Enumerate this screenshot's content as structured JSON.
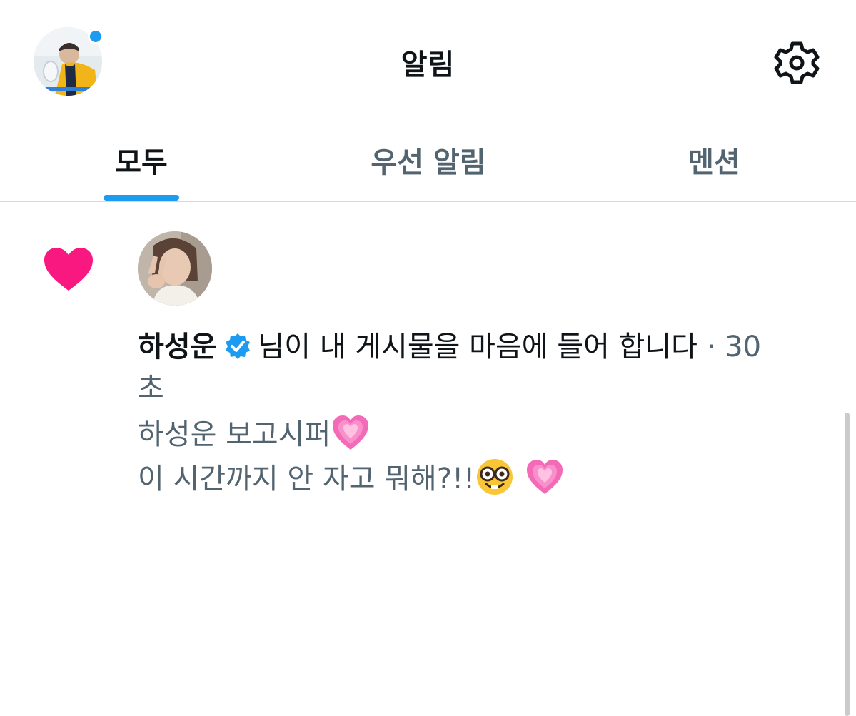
{
  "header": {
    "title": "알림",
    "avatar_icon": "profile-photo",
    "settings_icon": "gear-icon"
  },
  "tabs": [
    {
      "label": "모두",
      "active": true
    },
    {
      "label": "우선 알림",
      "active": false
    },
    {
      "label": "멘션",
      "active": false
    }
  ],
  "notification": {
    "type_icon": "heart-icon",
    "username": "하성운",
    "verified": true,
    "action_text": "님이 내 게시물을 마음에 들어 합니다",
    "time_line1": "· 30",
    "time_line2": "초",
    "post_line1": "하성운 보고시퍼",
    "post_line2": "이 시간까지 안 자고 뭐해?!!"
  },
  "colors": {
    "accent": "#1d9bf0",
    "heart": "#f91880",
    "secondary_text": "#536471",
    "primary_text": "#0f1419"
  }
}
